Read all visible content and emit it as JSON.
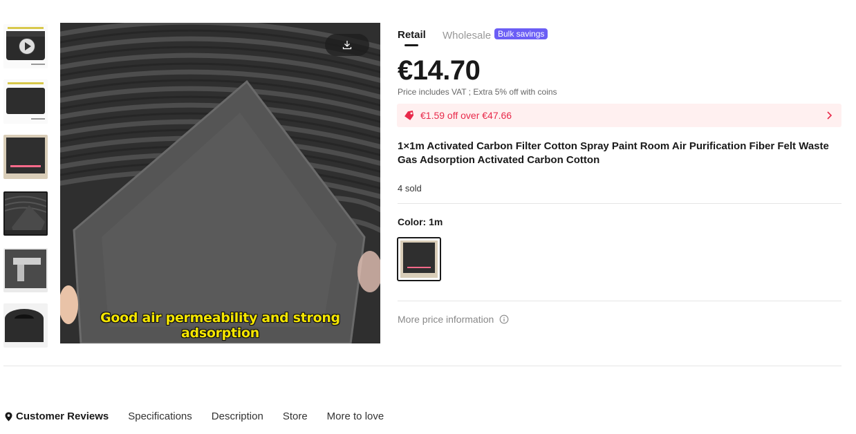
{
  "gallery": {
    "thumbnails": [
      {
        "name": "video-thumbnail",
        "has_play": true,
        "header_text": "Activated carbon filter cotton 1*1m"
      },
      {
        "name": "product-thumbnail",
        "header_text": "Activated carbon filter cotton 1*1m"
      },
      {
        "name": "size-thumbnail",
        "overlay_text": "1 meter long * 1 meter wide"
      },
      {
        "name": "closeup-thumbnail",
        "selected": true
      },
      {
        "name": "thickness-thumbnail"
      },
      {
        "name": "roll-thumbnail"
      }
    ],
    "main_image": {
      "caption": "Good air permeability and strong adsorption",
      "download_icon": "download-icon"
    }
  },
  "product": {
    "tabs": {
      "retail": "Retail",
      "wholesale": "Wholesale",
      "wholesale_badge": "Bulk savings"
    },
    "price": "€14.70",
    "vat_note": "Price includes VAT ; Extra 5% off with coins",
    "coupon": {
      "text": "€1.59 off over €47.66",
      "icon": "tag-icon",
      "color": "#e8294a"
    },
    "title": "1×1m Activated Carbon Filter Cotton Spray Paint Room Air Purification Fiber Felt Waste Gas Adsorption Activated Carbon Cotton",
    "sold": "4 sold",
    "color_label": "Color: 1m",
    "more_price_info": "More price information"
  },
  "nav": {
    "items": [
      "Customer Reviews",
      "Specifications",
      "Description",
      "Store",
      "More to love"
    ]
  },
  "colors": {
    "accent_badge": "#6b5ef5",
    "coupon_bg": "#fff0f0",
    "text_primary": "#191919"
  }
}
